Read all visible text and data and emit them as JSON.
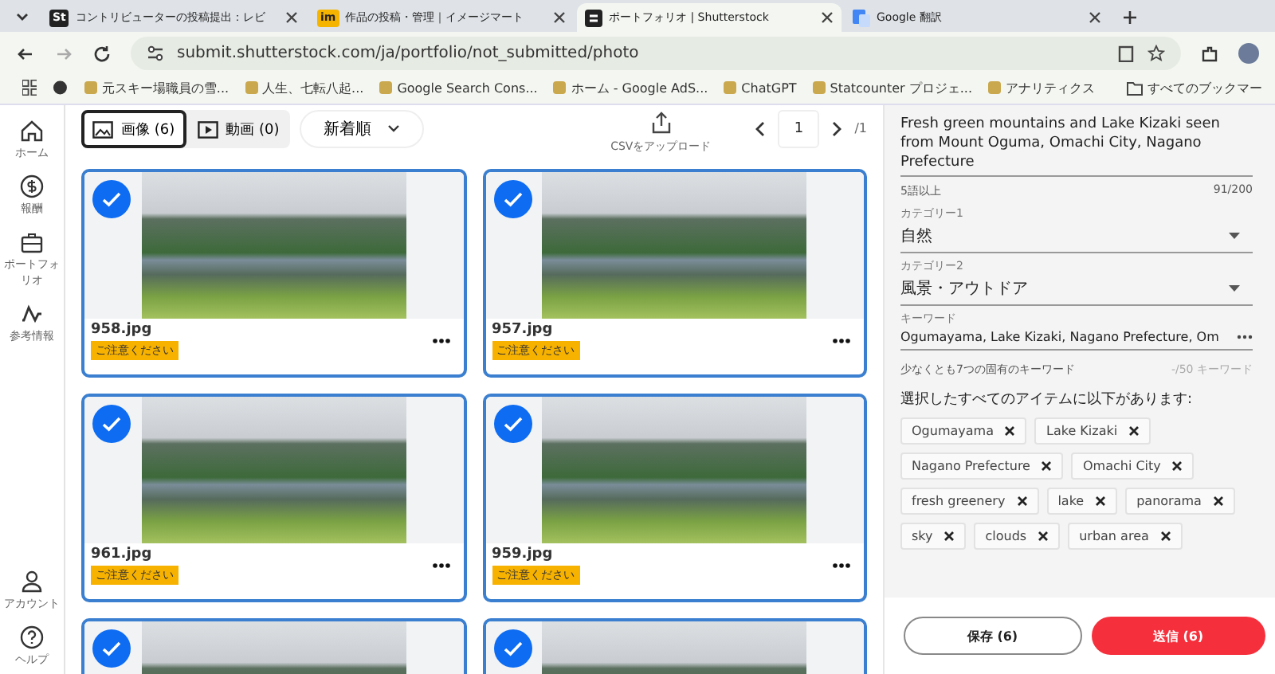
{
  "browser": {
    "tabs": [
      {
        "icon": "St",
        "title": "コントリビューターの投稿提出：レビ",
        "selected": false
      },
      {
        "icon": "im",
        "title": "作品の投稿・管理｜イメージマート",
        "selected": false
      },
      {
        "title": "ポートフォリオ | Shutterstock",
        "selected": true
      },
      {
        "title": "Google 翻訳",
        "selected": false
      }
    ],
    "url": "submit.shutterstock.com/ja/portfolio/not_submitted/photo",
    "bookmarks": [
      "元スキー場職員の雪...",
      "人生、七転八起...",
      "Google Search Cons...",
      "ホーム - Google AdS...",
      "ChatGPT",
      "Statcounter プロジェ...",
      "アナリティクス"
    ],
    "bookmarks_folder": "すべてのブックマー"
  },
  "sidebar": {
    "items": [
      {
        "label": "ホーム"
      },
      {
        "label": "報酬"
      },
      {
        "label": "ポートフォリオ"
      },
      {
        "label": "参考情報"
      }
    ],
    "bottom_items": [
      {
        "label": "アカウント"
      },
      {
        "label": "ヘルプ"
      }
    ]
  },
  "toolbar": {
    "media_tabs": [
      {
        "label": "画像 (6)",
        "selected": true
      },
      {
        "label": "動画 (0)",
        "selected": false
      }
    ],
    "sort": "新着順",
    "upload_label": "CSVをアップロード",
    "page": "1",
    "page_total": "/1"
  },
  "items": [
    {
      "filename": "958.jpg",
      "badge": "ご注意ください",
      "selected": true
    },
    {
      "filename": "957.jpg",
      "badge": "ご注意ください",
      "selected": true
    },
    {
      "filename": "961.jpg",
      "badge": "ご注意ください",
      "selected": true
    },
    {
      "filename": "959.jpg",
      "badge": "ご注意ください",
      "selected": true
    },
    {
      "selected": true
    },
    {
      "selected": true
    }
  ],
  "details": {
    "title": "Fresh green mountains and Lake Kizaki seen from Mount Oguma, Omachi City, Nagano Prefecture",
    "title_hint": "5語以上",
    "title_count": "91/200",
    "category1": {
      "label": "カテゴリー1",
      "value": "自然"
    },
    "category2": {
      "label": "カテゴリー2",
      "value": "風景・アウトドア"
    },
    "keywords": {
      "label": "キーワード",
      "value": "Ogumayama, Lake Kizaki, Nagano Prefecture, Om"
    },
    "keyword_hint": "少なくとも7つの固有のキーワード",
    "keyword_count": "-/50 キーワード",
    "tags_heading": "選択したすべてのアイテムに以下があります:",
    "tags": [
      "Ogumayama",
      "Lake Kizaki",
      "Nagano Prefecture",
      "Omachi City",
      "fresh greenery",
      "lake",
      "panorama",
      "sky",
      "clouds",
      "urban area"
    ],
    "save_button": "保存 (6)",
    "submit_button": "送信 (6)"
  }
}
